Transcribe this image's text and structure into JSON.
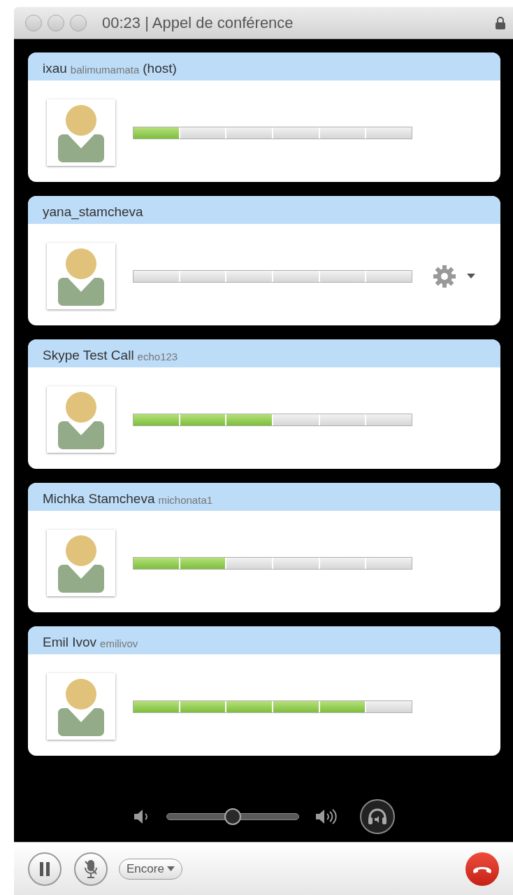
{
  "window": {
    "title": "00:23 | Appel de conférence"
  },
  "participants": [
    {
      "name": "ixau",
      "username": "balimumamata",
      "role": "(host)",
      "level": 0.1667,
      "settings_menu": false
    },
    {
      "name": "yana_stamcheva",
      "level": 0,
      "settings_menu": true
    },
    {
      "name": "Skype Test Call",
      "username": "echo123",
      "level": 0.5,
      "settings_menu": false
    },
    {
      "name": "Michka Stamcheva",
      "username": "michonata1",
      "level": 0.3333,
      "settings_menu": false
    },
    {
      "name": "Emil Ivov",
      "username": "emilivov",
      "level": 0.8333,
      "settings_menu": false
    }
  ],
  "volume": {
    "level": 0.5
  },
  "toolbar": {
    "more_button": "Encore"
  }
}
